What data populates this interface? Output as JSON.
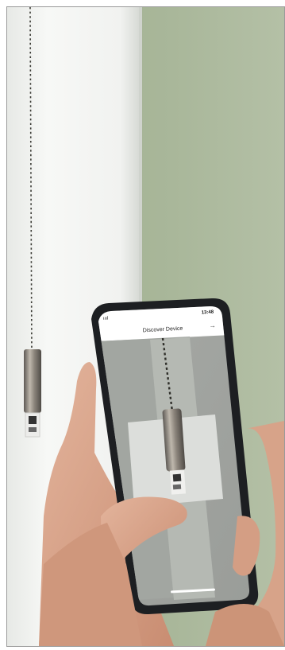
{
  "phone": {
    "time": "13:48",
    "screen_title": "Discover Device",
    "back_icon": "arrow-right-icon",
    "carrier_text": "ıııl"
  },
  "colors": {
    "wall_green": "#a5b394",
    "window_white": "#f2f3f1",
    "chain": "#3a3a34",
    "phone_body": "#1d1f22",
    "skin": "#d9a58c"
  }
}
